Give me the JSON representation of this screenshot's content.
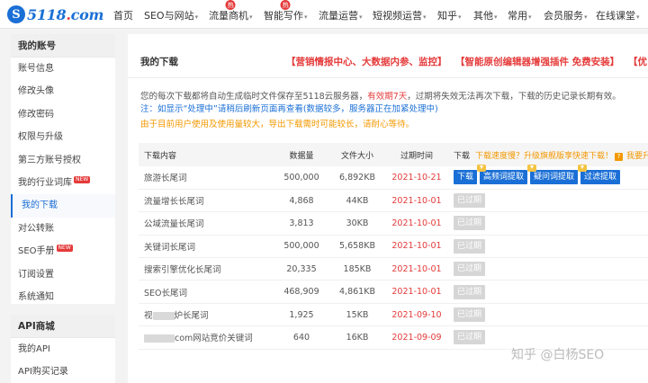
{
  "logo": {
    "mark": "S",
    "text_main": "5118",
    "text_dot": ".",
    "text_tail": "com"
  },
  "nav": [
    {
      "label": "首页",
      "hot": false,
      "caret": false
    },
    {
      "label": "SEO与网站",
      "hot": false,
      "caret": true
    },
    {
      "label": "流量商机",
      "hot": true,
      "caret": true
    },
    {
      "label": "智能写作",
      "hot": true,
      "caret": true
    },
    {
      "label": "流量运营",
      "hot": false,
      "caret": true
    },
    {
      "label": "短视频运营",
      "hot": false,
      "caret": true
    },
    {
      "label": "知乎",
      "hot": false,
      "caret": true
    },
    {
      "label": "其他",
      "hot": false,
      "caret": true
    },
    {
      "label": "常用",
      "hot": false,
      "caret": true
    },
    {
      "label": "会员服务",
      "hot": false,
      "caret": true
    },
    {
      "label": "在线课堂",
      "hot": false,
      "caret": true
    }
  ],
  "hot_label": "热",
  "caret_glyph": "▾",
  "sidebar": {
    "heading": "我的账号",
    "items": [
      {
        "label": "账号信息",
        "new": false,
        "active": false
      },
      {
        "label": "修改头像",
        "new": false,
        "active": false
      },
      {
        "label": "修改密码",
        "new": false,
        "active": false
      },
      {
        "label": "权限与升级",
        "new": false,
        "active": false
      },
      {
        "label": "第三方账号授权",
        "new": false,
        "active": false
      },
      {
        "label": "我的行业词库",
        "new": true,
        "active": false
      },
      {
        "label": "我的下载",
        "new": false,
        "active": true
      },
      {
        "label": "对公转账",
        "new": false,
        "active": false
      },
      {
        "label": "SEO手册",
        "new": true,
        "active": false
      },
      {
        "label": "订阅设置",
        "new": false,
        "active": false
      },
      {
        "label": "系统通知",
        "new": false,
        "active": false
      }
    ],
    "new_label": "NEW",
    "api_heading": "API商城",
    "api_items": [
      "我的API",
      "API购买记录"
    ]
  },
  "main": {
    "title": "我的下载",
    "promo1": "【营销情报中心、大数据内参、监控】",
    "promo2": "【智能原创编辑器增强插件 免费安装】",
    "promo3": "【优",
    "notice1_pre": "您的每次下载都将自动生成临时文件保存至5118云服务器，",
    "notice1_red": "有效期7天",
    "notice1_post": "，过期将失效无法再次下载，下载的历史记录长期有效。",
    "notice2": "注：如显示“处理中”请稍后刷新页面再查看(数据较多，服务器正在加紧处理中)",
    "notice3": "由于目前用户使用及使用量较大，导出下载需时可能较长，请耐心等待。"
  },
  "table": {
    "headers": {
      "name": "下载内容",
      "count": "数据量",
      "size": "文件大小",
      "date": "过期时间",
      "ops": "下载"
    },
    "ops_link": "下载速度慢？升级旗舰版享快速下载！",
    "ops_q": "?",
    "ops_link2": "我要升级",
    "buttons": {
      "download": "下载",
      "high": "高频词提取",
      "question": "疑问词提取",
      "filter": "过滤提取",
      "expired": "已过期"
    },
    "rows": [
      {
        "name": "旅游长尾词",
        "count": "500,000",
        "size": "6,892KB",
        "date": "2021-10-21",
        "expired": false
      },
      {
        "name": "流量增长长尾词",
        "count": "4,868",
        "size": "44KB",
        "date": "2021-10-01",
        "expired": true
      },
      {
        "name": "公域流量长尾词",
        "count": "3,813",
        "size": "30KB",
        "date": "2021-10-01",
        "expired": true
      },
      {
        "name": "关键词长尾词",
        "count": "500,000",
        "size": "5,658KB",
        "date": "2021-10-01",
        "expired": true
      },
      {
        "name": "搜索引擎优化长尾词",
        "count": "20,335",
        "size": "185KB",
        "date": "2021-10-01",
        "expired": true
      },
      {
        "name": "SEO长尾词",
        "count": "468,909",
        "size": "4,861KB",
        "date": "2021-10-01",
        "expired": true
      },
      {
        "name_pre": "视",
        "name_post": "炉长尾词",
        "blurred": true,
        "count": "1,925",
        "size": "15KB",
        "date": "2021-09-10",
        "expired": true
      },
      {
        "name_pre": "",
        "name_post": "com网站竞价关键词",
        "blurred": true,
        "count": "640",
        "size": "16KB",
        "date": "2021-09-09",
        "expired": true
      }
    ]
  },
  "watermark": "知乎 @白杨SEO",
  "colors": {
    "brand_blue": "#1a6fd6",
    "alert_red": "#e53a3a",
    "warn_orange": "#f39800",
    "expired_gray": "#d6d6d6"
  }
}
